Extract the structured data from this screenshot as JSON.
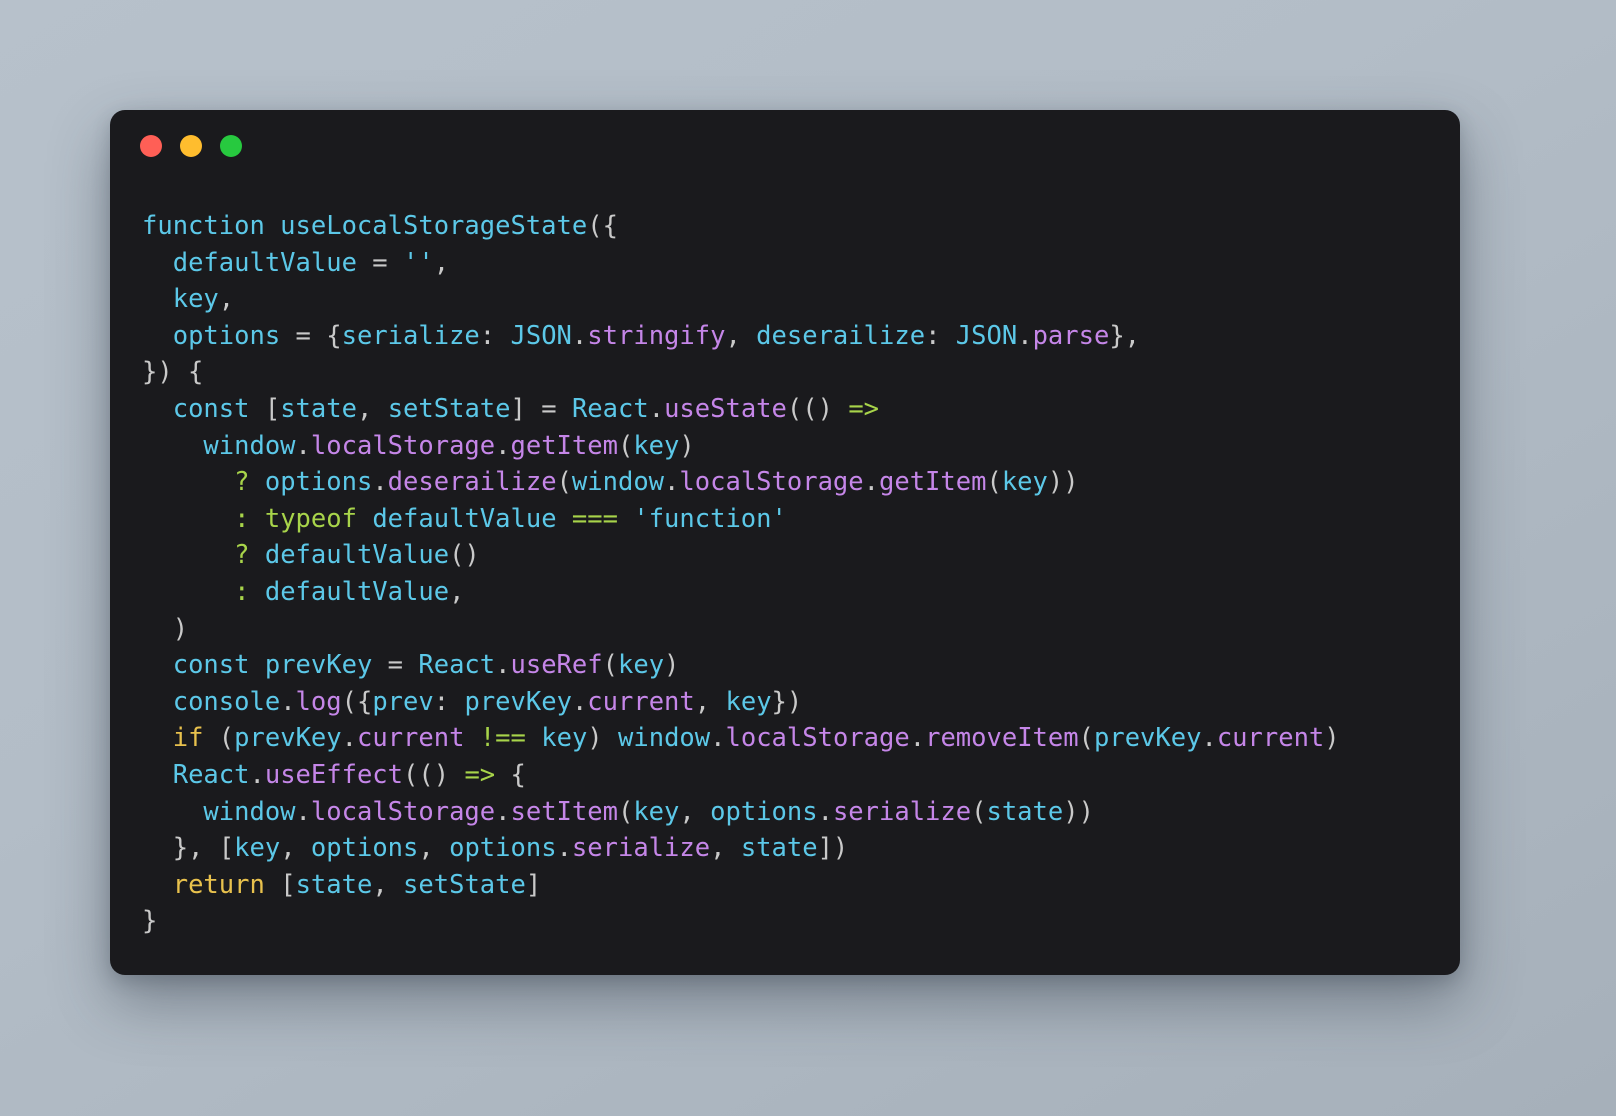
{
  "window": {
    "dots": [
      {
        "name": "close",
        "color": "#ff5f56"
      },
      {
        "name": "minimize",
        "color": "#ffbd2e"
      },
      {
        "name": "maximize",
        "color": "#27c93f"
      }
    ]
  },
  "theme": {
    "page_background": "#b4bec8",
    "card_background": "#1a1a1d",
    "identifier": "#5cc8e8",
    "property": "#c586e8",
    "operator": "#a8d44a",
    "keyword": "#e8c14d",
    "punctuation": "#c9c9c9"
  },
  "code": {
    "language": "javascript",
    "lines": [
      [
        {
          "t": "function ",
          "c": "id"
        },
        {
          "t": "useLocalStorageState",
          "c": "id"
        },
        {
          "t": "({",
          "c": "punc"
        }
      ],
      [
        {
          "t": "  ",
          "c": "punc"
        },
        {
          "t": "defaultValue",
          "c": "id"
        },
        {
          "t": " = ",
          "c": "punc"
        },
        {
          "t": "''",
          "c": "id"
        },
        {
          "t": ",",
          "c": "punc"
        }
      ],
      [
        {
          "t": "  ",
          "c": "punc"
        },
        {
          "t": "key",
          "c": "id"
        },
        {
          "t": ",",
          "c": "punc"
        }
      ],
      [
        {
          "t": "  ",
          "c": "punc"
        },
        {
          "t": "options",
          "c": "id"
        },
        {
          "t": " = ",
          "c": "punc"
        },
        {
          "t": "{",
          "c": "punc"
        },
        {
          "t": "serialize",
          "c": "id"
        },
        {
          "t": ": ",
          "c": "punc"
        },
        {
          "t": "JSON",
          "c": "id"
        },
        {
          "t": ".",
          "c": "punc"
        },
        {
          "t": "stringify",
          "c": "prop"
        },
        {
          "t": ", ",
          "c": "punc"
        },
        {
          "t": "deserailize",
          "c": "id"
        },
        {
          "t": ": ",
          "c": "punc"
        },
        {
          "t": "JSON",
          "c": "id"
        },
        {
          "t": ".",
          "c": "punc"
        },
        {
          "t": "parse",
          "c": "prop"
        },
        {
          "t": "},",
          "c": "punc"
        }
      ],
      [
        {
          "t": "}) {",
          "c": "punc"
        }
      ],
      [
        {
          "t": "  ",
          "c": "punc"
        },
        {
          "t": "const",
          "c": "id"
        },
        {
          "t": " ",
          "c": "punc"
        },
        {
          "t": "[",
          "c": "punc"
        },
        {
          "t": "state",
          "c": "id"
        },
        {
          "t": ", ",
          "c": "punc"
        },
        {
          "t": "setState",
          "c": "id"
        },
        {
          "t": "]",
          "c": "punc"
        },
        {
          "t": " = ",
          "c": "punc"
        },
        {
          "t": "React",
          "c": "id"
        },
        {
          "t": ".",
          "c": "punc"
        },
        {
          "t": "useState",
          "c": "prop"
        },
        {
          "t": "(() ",
          "c": "punc"
        },
        {
          "t": "=>",
          "c": "op"
        }
      ],
      [
        {
          "t": "    ",
          "c": "punc"
        },
        {
          "t": "window",
          "c": "id"
        },
        {
          "t": ".",
          "c": "punc"
        },
        {
          "t": "localStorage",
          "c": "prop"
        },
        {
          "t": ".",
          "c": "punc"
        },
        {
          "t": "getItem",
          "c": "prop"
        },
        {
          "t": "(",
          "c": "punc"
        },
        {
          "t": "key",
          "c": "id"
        },
        {
          "t": ")",
          "c": "punc"
        }
      ],
      [
        {
          "t": "      ",
          "c": "punc"
        },
        {
          "t": "?",
          "c": "op"
        },
        {
          "t": " ",
          "c": "punc"
        },
        {
          "t": "options",
          "c": "id"
        },
        {
          "t": ".",
          "c": "punc"
        },
        {
          "t": "deserailize",
          "c": "prop"
        },
        {
          "t": "(",
          "c": "punc"
        },
        {
          "t": "window",
          "c": "id"
        },
        {
          "t": ".",
          "c": "punc"
        },
        {
          "t": "localStorage",
          "c": "prop"
        },
        {
          "t": ".",
          "c": "punc"
        },
        {
          "t": "getItem",
          "c": "prop"
        },
        {
          "t": "(",
          "c": "punc"
        },
        {
          "t": "key",
          "c": "id"
        },
        {
          "t": "))",
          "c": "punc"
        }
      ],
      [
        {
          "t": "      ",
          "c": "punc"
        },
        {
          "t": ":",
          "c": "op"
        },
        {
          "t": " ",
          "c": "punc"
        },
        {
          "t": "typeof",
          "c": "op"
        },
        {
          "t": " ",
          "c": "punc"
        },
        {
          "t": "defaultValue",
          "c": "id"
        },
        {
          "t": " ",
          "c": "punc"
        },
        {
          "t": "===",
          "c": "op"
        },
        {
          "t": " ",
          "c": "punc"
        },
        {
          "t": "'function'",
          "c": "id"
        }
      ],
      [
        {
          "t": "      ",
          "c": "punc"
        },
        {
          "t": "?",
          "c": "op"
        },
        {
          "t": " ",
          "c": "punc"
        },
        {
          "t": "defaultValue",
          "c": "id"
        },
        {
          "t": "()",
          "c": "punc"
        }
      ],
      [
        {
          "t": "      ",
          "c": "punc"
        },
        {
          "t": ":",
          "c": "op"
        },
        {
          "t": " ",
          "c": "punc"
        },
        {
          "t": "defaultValue",
          "c": "id"
        },
        {
          "t": ",",
          "c": "punc"
        }
      ],
      [
        {
          "t": "  )",
          "c": "punc"
        }
      ],
      [
        {
          "t": "  ",
          "c": "punc"
        },
        {
          "t": "const",
          "c": "id"
        },
        {
          "t": " ",
          "c": "punc"
        },
        {
          "t": "prevKey",
          "c": "id"
        },
        {
          "t": " = ",
          "c": "punc"
        },
        {
          "t": "React",
          "c": "id"
        },
        {
          "t": ".",
          "c": "punc"
        },
        {
          "t": "useRef",
          "c": "prop"
        },
        {
          "t": "(",
          "c": "punc"
        },
        {
          "t": "key",
          "c": "id"
        },
        {
          "t": ")",
          "c": "punc"
        }
      ],
      [
        {
          "t": "  ",
          "c": "punc"
        },
        {
          "t": "console",
          "c": "id"
        },
        {
          "t": ".",
          "c": "punc"
        },
        {
          "t": "log",
          "c": "prop"
        },
        {
          "t": "({",
          "c": "punc"
        },
        {
          "t": "prev",
          "c": "id"
        },
        {
          "t": ": ",
          "c": "punc"
        },
        {
          "t": "prevKey",
          "c": "id"
        },
        {
          "t": ".",
          "c": "punc"
        },
        {
          "t": "current",
          "c": "prop"
        },
        {
          "t": ", ",
          "c": "punc"
        },
        {
          "t": "key",
          "c": "id"
        },
        {
          "t": "})",
          "c": "punc"
        }
      ],
      [
        {
          "t": "  ",
          "c": "punc"
        },
        {
          "t": "if",
          "c": "kw"
        },
        {
          "t": " (",
          "c": "punc"
        },
        {
          "t": "prevKey",
          "c": "id"
        },
        {
          "t": ".",
          "c": "punc"
        },
        {
          "t": "current",
          "c": "prop"
        },
        {
          "t": " ",
          "c": "punc"
        },
        {
          "t": "!==",
          "c": "op"
        },
        {
          "t": " ",
          "c": "punc"
        },
        {
          "t": "key",
          "c": "id"
        },
        {
          "t": ") ",
          "c": "punc"
        },
        {
          "t": "window",
          "c": "id"
        },
        {
          "t": ".",
          "c": "punc"
        },
        {
          "t": "localStorage",
          "c": "prop"
        },
        {
          "t": ".",
          "c": "punc"
        },
        {
          "t": "removeItem",
          "c": "prop"
        },
        {
          "t": "(",
          "c": "punc"
        },
        {
          "t": "prevKey",
          "c": "id"
        },
        {
          "t": ".",
          "c": "punc"
        },
        {
          "t": "current",
          "c": "prop"
        },
        {
          "t": ")",
          "c": "punc"
        }
      ],
      [
        {
          "t": "  ",
          "c": "punc"
        },
        {
          "t": "React",
          "c": "id"
        },
        {
          "t": ".",
          "c": "punc"
        },
        {
          "t": "useEffect",
          "c": "prop"
        },
        {
          "t": "(() ",
          "c": "punc"
        },
        {
          "t": "=>",
          "c": "op"
        },
        {
          "t": " {",
          "c": "punc"
        }
      ],
      [
        {
          "t": "    ",
          "c": "punc"
        },
        {
          "t": "window",
          "c": "id"
        },
        {
          "t": ".",
          "c": "punc"
        },
        {
          "t": "localStorage",
          "c": "prop"
        },
        {
          "t": ".",
          "c": "punc"
        },
        {
          "t": "setItem",
          "c": "prop"
        },
        {
          "t": "(",
          "c": "punc"
        },
        {
          "t": "key",
          "c": "id"
        },
        {
          "t": ", ",
          "c": "punc"
        },
        {
          "t": "options",
          "c": "id"
        },
        {
          "t": ".",
          "c": "punc"
        },
        {
          "t": "serialize",
          "c": "prop"
        },
        {
          "t": "(",
          "c": "punc"
        },
        {
          "t": "state",
          "c": "id"
        },
        {
          "t": "))",
          "c": "punc"
        }
      ],
      [
        {
          "t": "  }, ",
          "c": "punc"
        },
        {
          "t": "[",
          "c": "punc"
        },
        {
          "t": "key",
          "c": "id"
        },
        {
          "t": ", ",
          "c": "punc"
        },
        {
          "t": "options",
          "c": "id"
        },
        {
          "t": ", ",
          "c": "punc"
        },
        {
          "t": "options",
          "c": "id"
        },
        {
          "t": ".",
          "c": "punc"
        },
        {
          "t": "serialize",
          "c": "prop"
        },
        {
          "t": ", ",
          "c": "punc"
        },
        {
          "t": "state",
          "c": "id"
        },
        {
          "t": "])",
          "c": "punc"
        }
      ],
      [
        {
          "t": "  ",
          "c": "punc"
        },
        {
          "t": "return",
          "c": "kw"
        },
        {
          "t": " ",
          "c": "punc"
        },
        {
          "t": "[",
          "c": "punc"
        },
        {
          "t": "state",
          "c": "id"
        },
        {
          "t": ", ",
          "c": "punc"
        },
        {
          "t": "setState",
          "c": "id"
        },
        {
          "t": "]",
          "c": "punc"
        }
      ],
      [
        {
          "t": "}",
          "c": "punc"
        }
      ]
    ]
  }
}
